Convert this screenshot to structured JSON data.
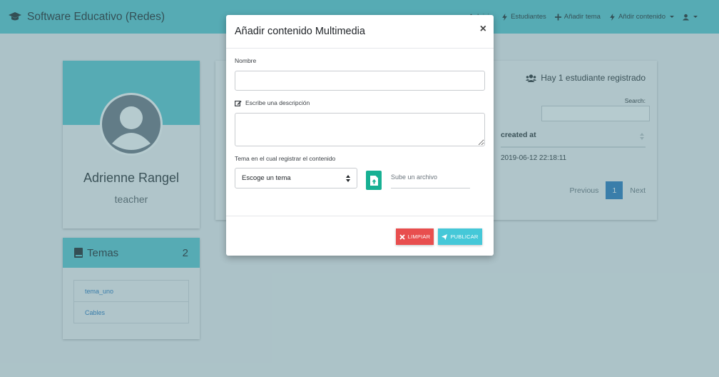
{
  "navbar": {
    "brand": "Software Educativo (Redes)",
    "items": [
      {
        "label": "Inicio",
        "icon": "home-icon"
      },
      {
        "label": "Estudiantes",
        "icon": "bolt-icon"
      },
      {
        "label": "Añadir tema",
        "icon": "plus-icon"
      },
      {
        "label": "Añdir contenido",
        "icon": "bolt-icon"
      }
    ]
  },
  "profile": {
    "name": "Adrienne Rangel",
    "role": "teacher"
  },
  "temas": {
    "title": "Temas",
    "count": "2",
    "items": [
      "tema_uno",
      "Cables"
    ]
  },
  "students_table": {
    "count_text": "Hay 1 estudiante registrado",
    "search_label": "Search:",
    "column_header": "created at",
    "rows": [
      [
        "2019-06-12 22:18:11"
      ]
    ],
    "pagination": {
      "previous": "Previous",
      "current": "1",
      "next": "Next"
    }
  },
  "modal": {
    "title": "Añadir contenido Multimedia",
    "close": "×",
    "name_label": "Nombre",
    "name_value": "",
    "description_label": "Escribe una descripción",
    "description_value": "",
    "topic_label": "Tema en el cual registrar el contenido",
    "topic_select": "Escoge un tema",
    "file_placeholder": "Sube un archivo",
    "clear_button": "LIMPIAR",
    "publish_button": "PUBLICAR"
  },
  "colors": {
    "navbar": "#5bc8d0",
    "upload": "#17b093",
    "clear": "#e84e4e",
    "publish": "#45c8d8",
    "link": "#2a7ac0"
  }
}
